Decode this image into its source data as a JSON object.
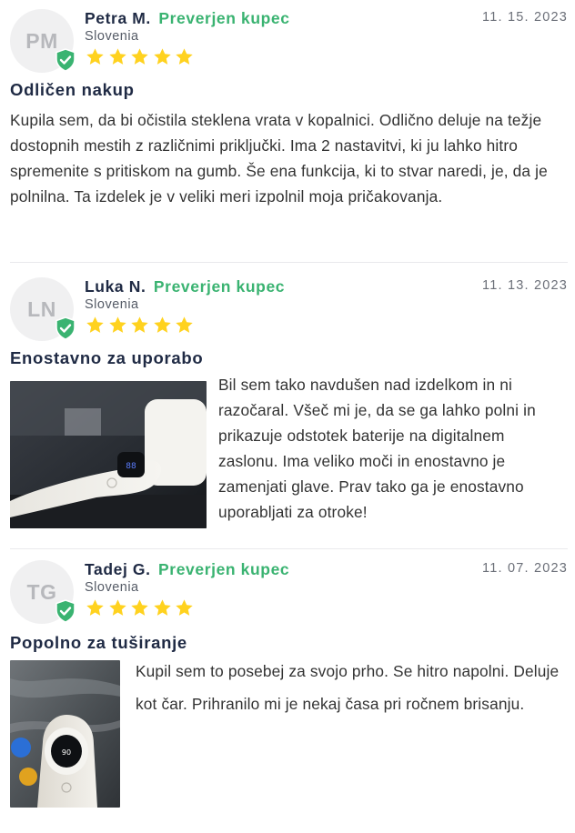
{
  "reviews": [
    {
      "initials": "PM",
      "name": "Petra M.",
      "verified_label": "Preverjen kupec",
      "country": "Slovenia",
      "date": "11. 15. 2023",
      "rating": 5,
      "title": "Odličen nakup",
      "body": "Kupila sem, da bi očistila steklena vrata v kopalnici. Odlično deluje na težje dostopnih mestih z različnimi priključki. Ima 2 nastavitvi, ki ju lahko hitro spremenite s pritiskom na gumb. Še ena funkcija, ki to stvar naredi, je, da je polnilna. Ta izdelek je v veliki meri izpolnil moja pričakovanja."
    },
    {
      "initials": "LN",
      "name": "Luka N.",
      "verified_label": "Preverjen kupec",
      "country": "Slovenia",
      "date": "11. 13. 2023",
      "rating": 5,
      "title": "Enostavno za uporabo",
      "body": "Bil sem tako navdušen nad izdelkom in ni razočaral. Všeč mi je, da se ga lahko polni in prikazuje odstotek baterije na digitalnem zaslonu. Ima veliko moči in enostavno je zamenjati glave. Prav tako ga je enostavno uporabljati za otroke!",
      "photo_display": "88"
    },
    {
      "initials": "TG",
      "name": "Tadej G.",
      "verified_label": "Preverjen kupec",
      "country": "Slovenia",
      "date": "11. 07. 2023",
      "rating": 5,
      "title": "Popolno za tuširanje",
      "body": "Kupil sem to posebej za svojo prho. Se hitro napolni. Deluje kot čar. Prihranilo mi je nekaj časa pri ročnem brisanju.",
      "photo_display": "90"
    }
  ],
  "colors": {
    "verified": "#3ab371",
    "star": "#ffd21f",
    "badge": "#3ab371",
    "name": "#1f2a44"
  }
}
